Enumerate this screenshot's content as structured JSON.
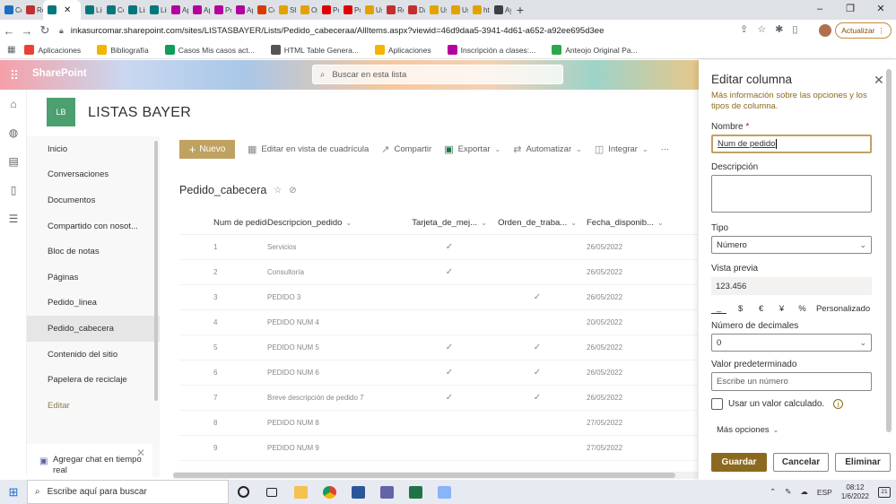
{
  "browser": {
    "tabs": [
      {
        "label": "Co",
        "color": "#1b6ec2"
      },
      {
        "label": "Re",
        "color": "#c03030"
      },
      {
        "label": "",
        "color": "#03787c",
        "active": true
      },
      {
        "label": "Lis",
        "color": "#03787c"
      },
      {
        "label": "Co",
        "color": "#03787c"
      },
      {
        "label": "Lis",
        "color": "#03787c"
      },
      {
        "label": "Lis",
        "color": "#03787c"
      },
      {
        "label": "Ap",
        "color": "#b4009e"
      },
      {
        "label": "Ap",
        "color": "#b4009e"
      },
      {
        "label": "Po",
        "color": "#b4009e"
      },
      {
        "label": "Ap",
        "color": "#b4009e"
      },
      {
        "label": "Co",
        "color": "#d83b01"
      },
      {
        "label": "Sh",
        "color": "#e2a300"
      },
      {
        "label": "Op",
        "color": "#e2a300"
      },
      {
        "label": "Po",
        "color": "#e00000"
      },
      {
        "label": "Po",
        "color": "#e00000"
      },
      {
        "label": "Us",
        "color": "#e2a300"
      },
      {
        "label": "Re",
        "color": "#c03030"
      },
      {
        "label": "Da",
        "color": "#c03030"
      },
      {
        "label": "Us",
        "color": "#e2a300"
      },
      {
        "label": "Us",
        "color": "#e2a300"
      },
      {
        "label": "htt",
        "color": "#e2a300"
      },
      {
        "label": "Ay",
        "color": "#3c4043"
      }
    ],
    "window_controls": {
      "minimize": "–",
      "restore": "❐",
      "close": "✕"
    },
    "url": "inkasurcomar.sharepoint.com/sites/LISTASBAYER/Lists/Pedido_cabeceraa/AllItems.aspx?viewid=46d9daa5-3941-4d61-a652-a92ee695d3ee",
    "update_label": "Actualizar",
    "bookmarks": [
      {
        "label": "Aplicaciones",
        "color": "#e94235"
      },
      {
        "label": "Bibliografía",
        "color": "#f4b400"
      },
      {
        "label": "Casos Mis casos act...",
        "color": "#0f9d58"
      },
      {
        "label": "HTML Table Genera...",
        "color": "#555555"
      },
      {
        "label": "Aplicaciones",
        "color": "#f4b400"
      },
      {
        "label": "Inscripción a clases:...",
        "color": "#b4009e"
      },
      {
        "label": "Anteojo Original Pa...",
        "color": "#2ba84a"
      }
    ]
  },
  "sharepoint": {
    "app_title": "SharePoint",
    "search_placeholder": "Buscar en esta lista",
    "site_logo": "LB",
    "site_name": "LISTAS BAYER",
    "nav": [
      "Inicio",
      "Conversaciones",
      "Documentos",
      "Compartido con nosot...",
      "Bloc de notas",
      "Páginas",
      "Pedido_linea",
      "Pedido_cabecera",
      "Contenido del sitio",
      "Papelera de reciclaje",
      "Editar"
    ],
    "nav_selected": "Pedido_cabecera",
    "chat_label": "Agregar chat en tiempo real",
    "commands": {
      "new": "Nuevo",
      "grid": "Editar en vista de cuadrícula",
      "share": "Compartir",
      "export": "Exportar",
      "automate": "Automatizar",
      "integrate": "Integrar",
      "more": "···"
    },
    "list_title": "Pedido_cabecera",
    "columns": [
      "Num de pedido",
      "Descripcion_pedido",
      "Tarjeta_de_mej...",
      "Orden_de_traba...",
      "Fecha_disponib..."
    ],
    "rows": [
      {
        "num": "1",
        "desc": "Servicios",
        "tarjeta": true,
        "orden": false,
        "fecha": "26/05/2022"
      },
      {
        "num": "2",
        "desc": "Consultoría",
        "tarjeta": true,
        "orden": false,
        "fecha": "26/05/2022"
      },
      {
        "num": "3",
        "desc": "PEDIDO 3",
        "tarjeta": false,
        "orden": true,
        "fecha": "26/05/2022"
      },
      {
        "num": "4",
        "desc": "PEDIDO NUM 4",
        "tarjeta": false,
        "orden": false,
        "fecha": "20/05/2022"
      },
      {
        "num": "5",
        "desc": "PEDIDO NUM 5",
        "tarjeta": true,
        "orden": true,
        "fecha": "26/05/2022"
      },
      {
        "num": "6",
        "desc": "PEDIDO NUM 6",
        "tarjeta": true,
        "orden": true,
        "fecha": "26/05/2022"
      },
      {
        "num": "7",
        "desc": "Breve descripción de pedido 7",
        "tarjeta": true,
        "orden": true,
        "fecha": "26/05/2022"
      },
      {
        "num": "8",
        "desc": "PEDIDO NUM 8",
        "tarjeta": false,
        "orden": false,
        "fecha": "27/05/2022"
      },
      {
        "num": "9",
        "desc": "PEDIDO NUM 9",
        "tarjeta": false,
        "orden": false,
        "fecha": "27/05/2022"
      }
    ]
  },
  "panel": {
    "title": "Editar columna",
    "info_link": "Más información sobre las opciones y los tipos de columna.",
    "name_label": "Nombre",
    "required_mark": "*",
    "name_value": "Num de pedido",
    "description_label": "Descripción",
    "description_value": "",
    "type_label": "Tipo",
    "type_value": "Número",
    "preview_label": "Vista previa",
    "preview_value": "123.456",
    "format_options": [
      "_",
      "$",
      "€",
      "¥",
      "%",
      "Personalizado"
    ],
    "decimals_label": "Número de decimales",
    "decimals_value": "0",
    "default_label": "Valor predeterminado",
    "default_placeholder": "Escribe un número",
    "calculated_label": "Usar un valor calculado.",
    "more_options": "Más opciones",
    "buttons": {
      "save": "Guardar",
      "cancel": "Cancelar",
      "delete": "Eliminar"
    }
  },
  "taskbar": {
    "search_placeholder": "Escribe aquí para buscar",
    "apps": [
      {
        "name": "circle",
        "color": "#222222"
      },
      {
        "name": "taskview",
        "color": "#222222"
      },
      {
        "name": "explorer",
        "color": "#f2c14e"
      },
      {
        "name": "chrome",
        "color": "#db4437"
      },
      {
        "name": "word",
        "color": "#2b579a"
      },
      {
        "name": "teams",
        "color": "#6264a7"
      },
      {
        "name": "excel",
        "color": "#217346"
      },
      {
        "name": "paint",
        "color": "#8ab4f8"
      }
    ],
    "language": "ESP",
    "time": "08:12",
    "date": "1/6/2022",
    "notifications": "21"
  },
  "colors": {
    "accent": "#8b6a1f",
    "new_button": "#bfa262",
    "site_logo": "#4c9f6e"
  }
}
